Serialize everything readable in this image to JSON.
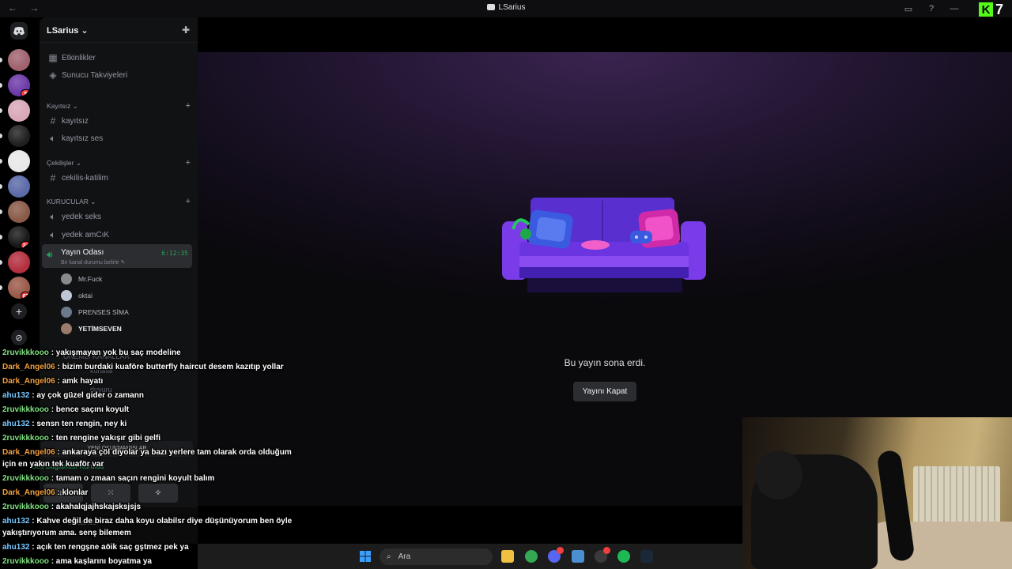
{
  "window": {
    "title": "LSarius",
    "nav": "← →"
  },
  "kick": {
    "letter": "K",
    "count": "7"
  },
  "rail": {
    "servers": [
      {
        "color": "#a0636e",
        "badge": ""
      },
      {
        "color": "#6c3aa8",
        "badge": "5"
      },
      {
        "color": "#d8a8b8",
        "badge": ""
      },
      {
        "color": "#202020",
        "badge": ""
      },
      {
        "color": "#e8e8e8",
        "badge": ""
      },
      {
        "color": "#5b6aa8",
        "badge": ""
      },
      {
        "color": "#8a5a48",
        "badge": ""
      },
      {
        "color": "#181818",
        "badge": "24"
      },
      {
        "color": "#b43040",
        "badge": ""
      },
      {
        "color": "#9a5a4a",
        "badge": "67"
      }
    ]
  },
  "guild": {
    "name": "LSarius",
    "chevron": "⌄"
  },
  "top_items": [
    {
      "icon": "calendar-icon",
      "label": "Etkinlikler"
    },
    {
      "icon": "boost-icon",
      "label": "Sunucu Takviyeleri"
    }
  ],
  "categories": {
    "kayitsiz": "Kayıtsız",
    "cekilisler": "Çekilişler",
    "kurucular": "KURUCULAR",
    "onemli": "ÖNEMLİ KANALLAR"
  },
  "channels": {
    "kayitsiz": "kayıtsız",
    "kayitsiz_ses": "kayıtsız ses",
    "cekilis": "cekilis-katilim",
    "yedek_seks": "yedek seks",
    "yedek_amcik": "yedek amCıK",
    "yayin_odasi": "Yayın Odası",
    "yayin_sub": "Bir kanal durumu belirle",
    "yayin_time": "6:12:35"
  },
  "voice_users": [
    {
      "name": "Mr.Fuck",
      "color": "#8a8a8a",
      "bright": false
    },
    {
      "name": "oktai",
      "color": "#c0c8d8",
      "bright": false
    },
    {
      "name": "PRENSES SİMA",
      "color": "#6a7a8a",
      "bright": false
    },
    {
      "name": "YETİMSEVEN",
      "color": "#9a7a6a",
      "bright": true
    }
  ],
  "ghost": {
    "kurallar": "kurallar",
    "duyuru": "duyuru",
    "unread": "YENİ OKUNMAMIŞLAR",
    "connected": "Ses Bağlantısı Kuruldu",
    "username": "xmsarius"
  },
  "stream": {
    "ended": "Bu yayın sona erdi.",
    "close": "Yayını Kapat"
  },
  "taskbar": {
    "search": "Ara",
    "apps": [
      {
        "name": "file-explorer-icon",
        "color": "#f0c040"
      },
      {
        "name": "chrome-icon",
        "color": "#34a853"
      },
      {
        "name": "discord-icon",
        "color": "#5865f2",
        "badge": true
      },
      {
        "name": "app-window-icon",
        "color": "#4a90d0"
      },
      {
        "name": "obs-icon",
        "color": "#3a3a3a",
        "badge": true
      },
      {
        "name": "spotify-icon",
        "color": "#1db954"
      },
      {
        "name": "steam-icon",
        "color": "#1b2838"
      }
    ]
  },
  "chat": [
    {
      "user": "2ruvikkkooo",
      "color": "#7ee07e",
      "text": ": yakışmayan yok bu saç modeline"
    },
    {
      "user": "Dark_Angel06",
      "color": "#f0a040",
      "text": ": bizim burdaki kuaföre butterfly haircut desem kazıtıp yollar"
    },
    {
      "user": "Dark_Angel06",
      "color": "#f0a040",
      "text": ": amk hayatı"
    },
    {
      "user": "ahu132",
      "color": "#78c8ff",
      "text": ": ay çok güzel gider o zamann"
    },
    {
      "user": "2ruvikkkooo",
      "color": "#7ee07e",
      "text": ": bence saçını koyult"
    },
    {
      "user": "ahu132",
      "color": "#78c8ff",
      "text": ": sensn ten rengin, ney ki"
    },
    {
      "user": "2ruvikkkooo",
      "color": "#7ee07e",
      "text": ": ten rengine yakışır gibi gelfi"
    },
    {
      "user": "Dark_Angel06",
      "color": "#f0a040",
      "text": ": ankaraya çöl diyolar ya bazı yerlere tam olarak orda olduğum için en yakın tek kuaför var",
      "wrap": true
    },
    {
      "user": "2ruvikkkooo",
      "color": "#7ee07e",
      "text": ": tamam o zmaan saçın rengini koyult balım"
    },
    {
      "user": "Dark_Angel06",
      "color": "#f0a040",
      "text": ": klonlar"
    },
    {
      "user": "2ruvikkkooo",
      "color": "#7ee07e",
      "text": ": akahalqjajhskajsksjsjs"
    },
    {
      "user": "ahu132",
      "color": "#78c8ff",
      "text": ": Kahve değil de biraz daha koyu olabilsr diye düşünüyorum ben öyle yakıştırıyorum ama. senş bilemem",
      "wrap": true
    },
    {
      "user": "ahu132",
      "color": "#78c8ff",
      "text": ": açık ten rengşne aöik saç gştmez pek ya"
    },
    {
      "user": "2ruvikkkooo",
      "color": "#7ee07e",
      "text": ": ama kaşlarını boyatma ya"
    }
  ]
}
